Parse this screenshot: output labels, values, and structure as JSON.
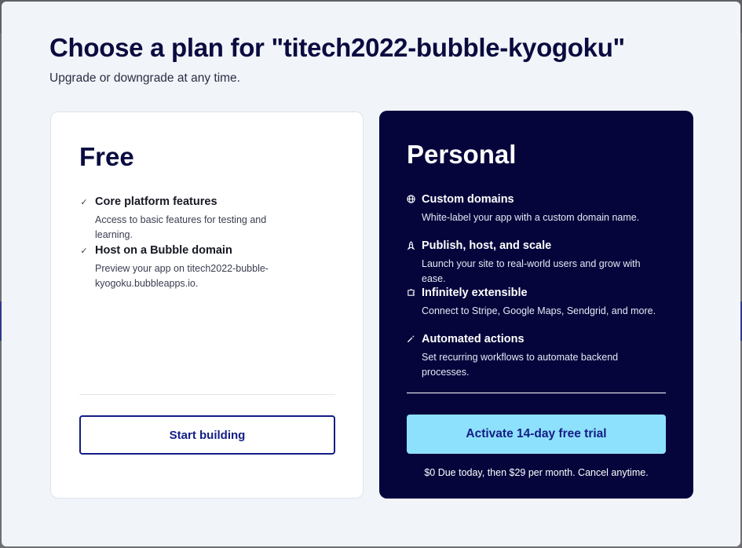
{
  "modal": {
    "title": "Choose a plan for \"titech2022-bubble-kyogoku\"",
    "subtitle": "Upgrade or downgrade at any time."
  },
  "free_plan": {
    "name": "Free",
    "features": [
      {
        "icon": "check-icon",
        "title": "Core platform features",
        "desc": "Access to basic features for testing and learning."
      },
      {
        "icon": "check-icon",
        "title": "Host on a Bubble domain",
        "desc": "Preview your app on titech2022-bubble-kyogoku.bubbleapps.io."
      }
    ],
    "button_label": "Start building"
  },
  "personal_plan": {
    "name": "Personal",
    "features": [
      {
        "icon": "globe-icon",
        "title": "Custom domains",
        "desc": "White-label your app with a custom domain name."
      },
      {
        "icon": "rocket-icon",
        "title": "Publish, host, and scale",
        "desc": "Launch your site to real-world users and grow with ease."
      },
      {
        "icon": "puzzle-icon",
        "title": "Infinitely extensible",
        "desc": "Connect to Stripe, Google Maps, Sendgrid, and more."
      },
      {
        "icon": "magic-wand-icon",
        "title": "Automated actions",
        "desc": "Set recurring workflows to automate backend processes."
      }
    ],
    "button_label": "Activate 14-day free trial",
    "fine_print": "$0 Due today, then $29 per month. Cancel anytime."
  },
  "colors": {
    "navy": "#05053c",
    "accent_blue": "#131d85",
    "trial_button": "#8ee1fd",
    "modal_bg": "#f1f4f9"
  }
}
